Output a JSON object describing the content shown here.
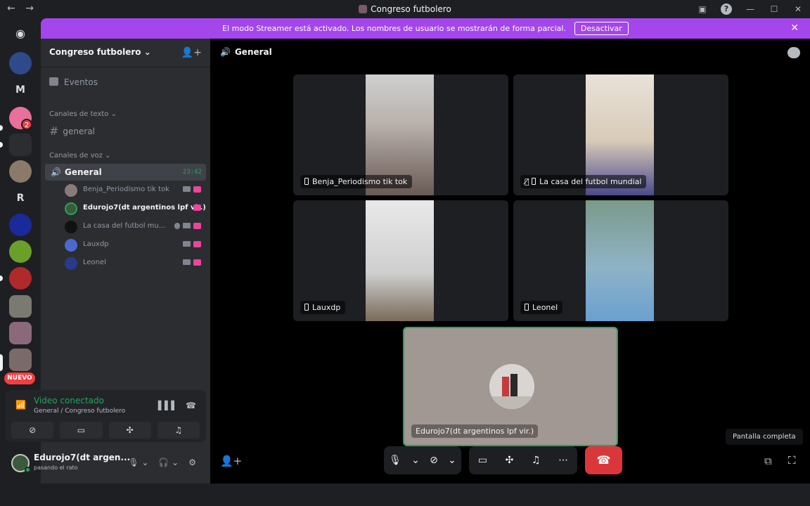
{
  "window": {
    "title": "Congreso futbolero",
    "nav_back": "←",
    "nav_forward": "→",
    "help": "?",
    "minimize": "—",
    "maximize": "☐",
    "close": "✕"
  },
  "banner": {
    "text": "El modo Streamer está activado. Los nombres de usuario se mostrarán de forma parcial.",
    "button": "Desactivar",
    "close": "✕"
  },
  "guilds": {
    "home_glyph": "◉",
    "letters": [
      "M",
      "R"
    ],
    "badge_count": "2",
    "new_label": "NUEVO"
  },
  "sidebar": {
    "server_name": "Congreso futbolero ⌄",
    "add_icon": "👤+",
    "events": "Eventos",
    "text_category": "Canales de texto ⌄",
    "text_channel": "general",
    "voice_category": "Canales de voz ⌄",
    "voice_channel": {
      "name": "General",
      "time": "23:42"
    },
    "users": [
      {
        "name": "Benja_Periodismo tik tok",
        "speaking": false,
        "muted": false
      },
      {
        "name": "Edurojo7(dt argentinos lpf vir.)",
        "speaking": true,
        "muted": false
      },
      {
        "name": "La casa del futbol mu...",
        "speaking": false,
        "muted": true
      },
      {
        "name": "Lauxdp",
        "speaking": false,
        "muted": false
      },
      {
        "name": "Leonel",
        "speaking": false,
        "muted": false
      }
    ]
  },
  "voice_panel": {
    "status": "Video conectado",
    "subtitle": "General / Congreso futbolero"
  },
  "user_panel": {
    "name": "Edurojo7(dt argen...",
    "status": "pasando el rato"
  },
  "main": {
    "channel": "General",
    "tiles": [
      {
        "name": "Benja_Periodismo tik tok",
        "muted": false
      },
      {
        "name": "La casa del futbol mundial",
        "muted": true
      },
      {
        "name": "Lauxdp",
        "muted": false
      },
      {
        "name": "Leonel",
        "muted": false
      }
    ],
    "self_name": "Edurojo7(dt argentinos lpf vir.)",
    "tooltip": "Pantalla completa"
  }
}
